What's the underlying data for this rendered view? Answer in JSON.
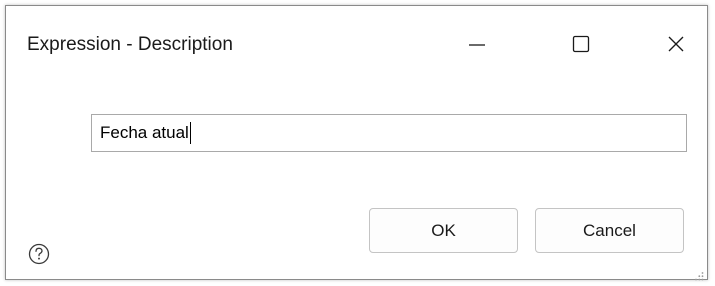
{
  "window": {
    "title": "Expression - Description",
    "controls": {
      "minimize": "minimize-icon",
      "maximize": "maximize-icon",
      "close": "close-icon"
    }
  },
  "field": {
    "value": "Fecha atual"
  },
  "buttons": {
    "ok": "OK",
    "cancel": "Cancel"
  },
  "icons": {
    "help": "help-icon",
    "resize": "resize-grip-icon"
  }
}
